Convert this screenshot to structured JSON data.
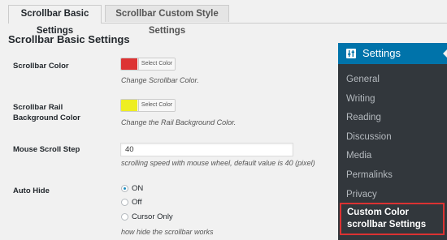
{
  "tabs": [
    {
      "label": "Scrollbar Basic Settings",
      "active": true
    },
    {
      "label": "Scrollbar Custom Style Settings",
      "active": false
    }
  ],
  "section_title": "Scrollbar Basic Settings",
  "fields": {
    "scrollbar_color": {
      "label": "Scrollbar Color",
      "swatch_color": "#dd3333",
      "button_label": "Select Color",
      "description": "Change Scrollbar Color."
    },
    "rail_color": {
      "label": "Scrollbar Rail Background Color",
      "swatch_color": "#eeee22",
      "button_label": "Select Color",
      "description": "Change the Rail Background Color."
    },
    "mouse_scroll_step": {
      "label": "Mouse Scroll Step",
      "value": "40",
      "description": "scrolling speed with mouse wheel, default value is 40 (pixel)"
    },
    "auto_hide": {
      "label": "Auto Hide",
      "options": [
        {
          "label": "ON",
          "checked": true
        },
        {
          "label": "Off",
          "checked": false
        },
        {
          "label": "Cursor Only",
          "checked": false
        }
      ],
      "description": "how hide the scrollbar works"
    }
  },
  "admin_menu": {
    "header": "Settings",
    "header_icon": "settings-sliders-icon",
    "items": [
      "General",
      "Writing",
      "Reading",
      "Discussion",
      "Media",
      "Permalinks",
      "Privacy"
    ],
    "custom_item_line1": "Custom Color",
    "custom_item_line2": "scrollbar Settings"
  },
  "colors": {
    "accent": "#0073aa",
    "menu_bg": "#23282d",
    "submenu_bg": "#32373c",
    "highlight_border": "#dc3232",
    "radio_checked": "#1e8cbe"
  }
}
